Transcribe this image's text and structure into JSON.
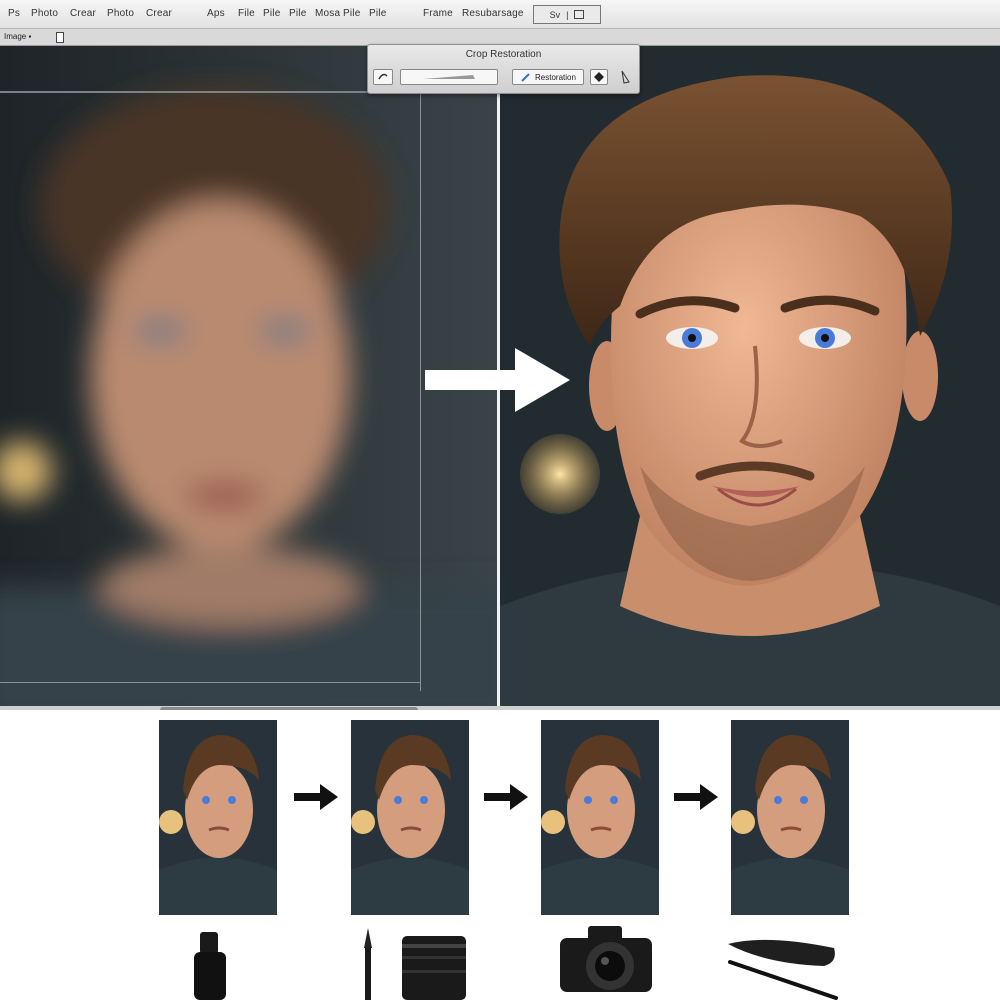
{
  "menubar": {
    "items": [
      "Ps",
      "Photo",
      "Crear",
      "Photo",
      "Crear",
      "Aps",
      "File",
      "Pile",
      "Pile",
      "Mosa",
      "Pile",
      "Pile",
      "Frame",
      "Resubarsage"
    ],
    "box_label": "Sv",
    "box_sep": "|"
  },
  "optionbar": {
    "label": "Image ▪"
  },
  "toolbox": {
    "title": "Crop Restoration",
    "field_label": "Restoration"
  },
  "colors": {
    "canvas_bg": "#1c2327",
    "panel_left": "#2a3135",
    "panel_right": "#20282c",
    "skin": "#e2a98b",
    "hair": "#5a3a22",
    "eye": "#4b7bd8",
    "shirt": "#2d3a40",
    "bokeh": "#f6d38a"
  },
  "icons": [
    "lasso-icon",
    "crop-icon",
    "brush-icon",
    "diamond-icon",
    "pen-icon",
    "arrow-right-icon",
    "camera-icon",
    "lens-icon",
    "brush-tool-icon",
    "pen-tool-icon"
  ]
}
